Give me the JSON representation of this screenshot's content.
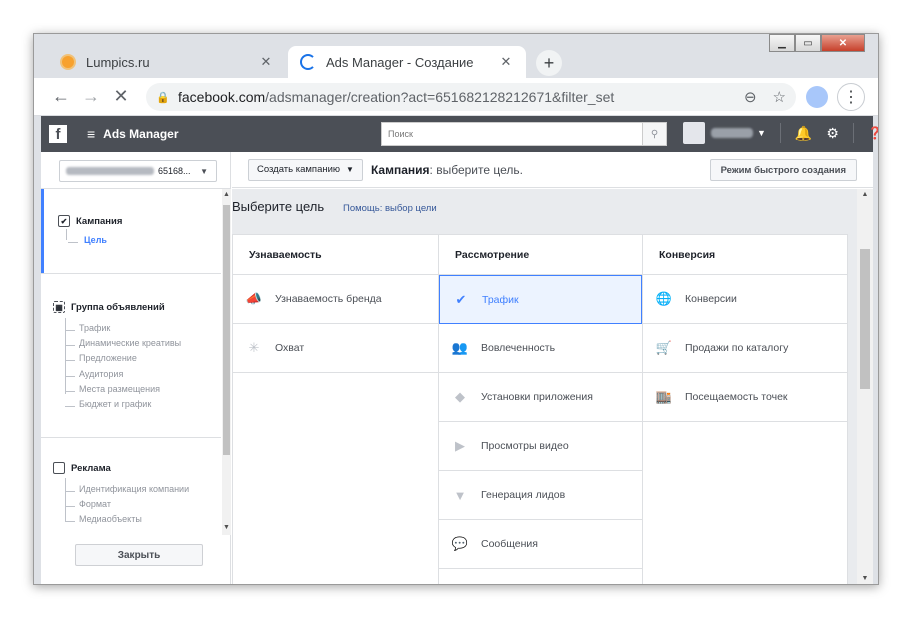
{
  "browser": {
    "tabs": [
      {
        "title": "Lumpics.ru",
        "icon": "lumpics-favicon"
      },
      {
        "title": "Ads Manager - Создание",
        "icon": "loading-spinner"
      }
    ],
    "new_tab": "+",
    "url_host": "facebook.com",
    "url_path": "/adsmanager/creation?act=651682128212671&filter_set"
  },
  "fb_header": {
    "logo": "f",
    "app_title": "Ads Manager",
    "search_placeholder": "Поиск"
  },
  "left_panel": {
    "account_suffix": "65168...",
    "sections": [
      {
        "title": "Кампания",
        "items": [
          "Цель"
        ],
        "selected_item": "Цель"
      },
      {
        "title": "Группа объявлений",
        "items": [
          "Трафик",
          "Динамические креативы",
          "Предложение",
          "Аудитория",
          "Места размещения",
          "Бюджет и график"
        ]
      },
      {
        "title": "Реклама",
        "items": [
          "Идентификация компании",
          "Формат",
          "Медиаобъекты"
        ]
      }
    ],
    "close_button": "Закрыть"
  },
  "topbar": {
    "create_button": "Создать кампанию",
    "crumb_bold": "Кампания",
    "crumb_rest": ": выберите цель.",
    "quick_mode_button": "Режим быстрого создания"
  },
  "goal": {
    "title": "Выберите цель",
    "help_link": "Помощь: выбор цели",
    "columns": [
      {
        "header": "Узнаваемость",
        "items": [
          {
            "label": "Узнаваемость бренда",
            "icon": "megaphone-icon"
          },
          {
            "label": "Охват",
            "icon": "reach-icon"
          }
        ]
      },
      {
        "header": "Рассмотрение",
        "items": [
          {
            "label": "Трафик",
            "icon": "check-circle-icon",
            "selected": true
          },
          {
            "label": "Вовлеченность",
            "icon": "people-icon"
          },
          {
            "label": "Установки приложения",
            "icon": "box-icon"
          },
          {
            "label": "Просмотры видео",
            "icon": "video-icon"
          },
          {
            "label": "Генерация лидов",
            "icon": "funnel-icon"
          },
          {
            "label": "Сообщения",
            "icon": "chat-icon"
          }
        ]
      },
      {
        "header": "Конверсия",
        "items": [
          {
            "label": "Конверсии",
            "icon": "globe-icon"
          },
          {
            "label": "Продажи по каталогу",
            "icon": "cart-icon"
          },
          {
            "label": "Посещаемость точек",
            "icon": "store-icon"
          }
        ]
      }
    ]
  },
  "colors": {
    "fb_header": "#4b4f56",
    "accent": "#4080ff",
    "selected_bg": "#ecf3ff"
  }
}
